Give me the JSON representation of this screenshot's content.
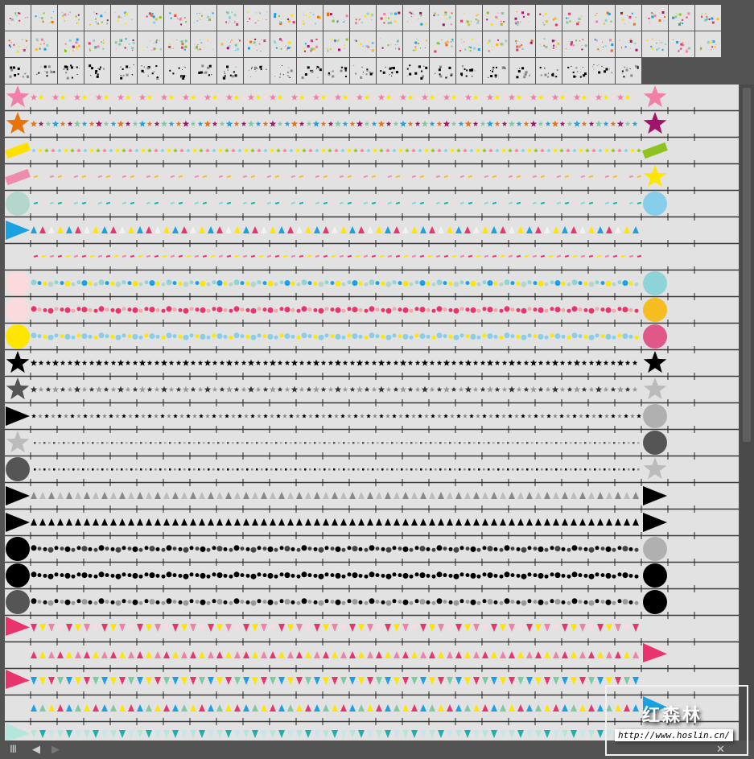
{
  "panel": {
    "watermark_title": "红森林",
    "watermark_url": "http://www.hoslin.cn/",
    "bottom_icons": [
      "brush-libraries-menu-icon",
      "previous-library-icon",
      "next-library-icon",
      "delete-brush-icon"
    ]
  },
  "thumbnail_rows": [
    {
      "count": 27,
      "style": "color"
    },
    {
      "count": 27,
      "style": "color"
    },
    {
      "count": 24,
      "style": "black"
    }
  ],
  "palette": [
    "#f080a8",
    "#ffe600",
    "#e8336d",
    "#1ba1e2",
    "#7ecba1",
    "#f6bd23",
    "#e8720c",
    "#8ed3d8",
    "#a0146a",
    "#8dc21f"
  ],
  "brush_rows": [
    {
      "left": {
        "shape": "star",
        "color": "#f080a8"
      },
      "right": {
        "shape": "star",
        "color": "#f080a8"
      },
      "pattern": {
        "shape": "star",
        "colors": [
          "#f080a8",
          "#ffe600",
          "#fadadd"
        ]
      }
    },
    {
      "left": {
        "shape": "star",
        "color": "#e8720c"
      },
      "right": {
        "shape": "star",
        "color": "#a0146a"
      },
      "pattern": {
        "shape": "star",
        "colors": [
          "#e8720c",
          "#a0146a",
          "#7ecba1",
          "#1ba1e2"
        ]
      }
    },
    {
      "left": {
        "shape": "rect",
        "color": "#ffe000"
      },
      "right": {
        "shape": "rect",
        "color": "#8dc21f"
      },
      "pattern": {
        "shape": "mix",
        "colors": [
          "#87ceeb",
          "#ffe600",
          "#8dc21f",
          "#f080a8"
        ]
      }
    },
    {
      "left": {
        "shape": "rect",
        "color": "#f08cab"
      },
      "right": {
        "shape": "star",
        "color": "#ffe600"
      },
      "pattern": {
        "shape": "dash",
        "colors": [
          "#f6bd23",
          "#fadadd",
          "#f08cab"
        ]
      }
    },
    {
      "left": {
        "shape": "circle",
        "color": "#b5d6cc"
      },
      "right": {
        "shape": "circle",
        "color": "#87ceeb"
      },
      "pattern": {
        "shape": "dash",
        "colors": [
          "#1bb0b0",
          "#fadadd",
          "#8ed3d8"
        ]
      }
    },
    {
      "left": {
        "shape": "tri",
        "color": "#1ba1e2"
      },
      "right": null,
      "pattern": {
        "shape": "tri",
        "colors": [
          "#1ba1e2",
          "#e8336d",
          "#f2f2f2",
          "#ffe600"
        ]
      }
    },
    {
      "left": null,
      "right": null,
      "pattern": {
        "shape": "dash",
        "colors": [
          "#e8336d",
          "#ffe600",
          "#f080a8"
        ]
      }
    },
    {
      "left": {
        "shape": "circle",
        "color": "#fadadd"
      },
      "right": {
        "shape": "circle",
        "color": "#8ed3d8"
      },
      "pattern": {
        "shape": "dot",
        "colors": [
          "#8ed3d8",
          "#1ba1e2",
          "#ffe600",
          "#b5d6cc"
        ]
      }
    },
    {
      "left": {
        "shape": "circle",
        "color": "#fadadd"
      },
      "right": {
        "shape": "circle",
        "color": "#f6bd23"
      },
      "pattern": {
        "shape": "dot",
        "colors": [
          "#e8336d",
          "#f4a9a0",
          "#e8336d"
        ]
      }
    },
    {
      "left": {
        "shape": "circle",
        "color": "#ffe600"
      },
      "right": {
        "shape": "circle",
        "color": "#e0588a"
      },
      "pattern": {
        "shape": "dot",
        "colors": [
          "#87ceeb",
          "#87ceeb",
          "#ffe600"
        ]
      }
    },
    {
      "left": {
        "shape": "star",
        "color": "#000000"
      },
      "right": {
        "shape": "star",
        "color": "#000000"
      },
      "pattern": {
        "shape": "star",
        "colors": [
          "#000000"
        ]
      }
    },
    {
      "left": {
        "shape": "star",
        "color": "#555555"
      },
      "right": {
        "shape": "star",
        "color": "#bbbbbb"
      },
      "pattern": {
        "shape": "star",
        "colors": [
          "#333333",
          "#999999"
        ]
      }
    },
    {
      "left": {
        "shape": "tri",
        "color": "#000000"
      },
      "right": {
        "shape": "circle",
        "color": "#b0b0b0"
      },
      "pattern": {
        "shape": "mix",
        "colors": [
          "#000000",
          "#888888"
        ]
      }
    },
    {
      "left": {
        "shape": "star",
        "color": "#bbbbbb"
      },
      "right": {
        "shape": "circle",
        "color": "#555555"
      },
      "pattern": {
        "shape": "tiny",
        "colors": [
          "#555555",
          "#aaaaaa"
        ]
      }
    },
    {
      "left": {
        "shape": "circle",
        "color": "#555555"
      },
      "right": {
        "shape": "star",
        "color": "#bbbbbb"
      },
      "pattern": {
        "shape": "tiny",
        "colors": [
          "#000000",
          "#888888"
        ]
      }
    },
    {
      "left": {
        "shape": "tri",
        "color": "#000000"
      },
      "right": {
        "shape": "tri",
        "color": "#000000"
      },
      "pattern": {
        "shape": "tri",
        "colors": [
          "#888888",
          "#bbbbbb"
        ]
      }
    },
    {
      "left": {
        "shape": "tri",
        "color": "#000000"
      },
      "right": {
        "shape": "tri",
        "color": "#000000"
      },
      "pattern": {
        "shape": "tri",
        "colors": [
          "#000000"
        ]
      }
    },
    {
      "left": {
        "shape": "circle",
        "color": "#000000"
      },
      "right": {
        "shape": "circle",
        "color": "#b0b0b0"
      },
      "pattern": {
        "shape": "dot",
        "colors": [
          "#000000",
          "#444444"
        ]
      }
    },
    {
      "left": {
        "shape": "circle",
        "color": "#000000"
      },
      "right": {
        "shape": "circle",
        "color": "#000000"
      },
      "pattern": {
        "shape": "dot",
        "colors": [
          "#000000"
        ]
      }
    },
    {
      "left": {
        "shape": "circle",
        "color": "#555555"
      },
      "right": {
        "shape": "circle",
        "color": "#000000"
      },
      "pattern": {
        "shape": "dot",
        "colors": [
          "#000000",
          "#999999"
        ]
      }
    },
    {
      "left": {
        "shape": "flag",
        "color": "#e8336d"
      },
      "right": null,
      "pattern": {
        "shape": "pennant",
        "colors": [
          "#e8336d",
          "#ffe600",
          "#f080a8",
          "#fadadd"
        ]
      }
    },
    {
      "left": null,
      "right": {
        "shape": "flag",
        "color": "#e8336d"
      },
      "pattern": {
        "shape": "tri",
        "colors": [
          "#e8336d",
          "#ffe600",
          "#f080a8"
        ]
      }
    },
    {
      "left": {
        "shape": "flag",
        "color": "#e8336d"
      },
      "right": null,
      "pattern": {
        "shape": "pennant",
        "colors": [
          "#1ba1e2",
          "#ffe600",
          "#e8336d",
          "#7ecba1"
        ]
      }
    },
    {
      "left": null,
      "right": {
        "shape": "flag",
        "color": "#1ba1e2"
      },
      "pattern": {
        "shape": "tri",
        "colors": [
          "#1ba1e2",
          "#7ecba1",
          "#ffe600",
          "#e8336d"
        ]
      }
    },
    {
      "left": {
        "shape": "flag",
        "color": "#b5e6dc"
      },
      "right": null,
      "pattern": {
        "shape": "pennant",
        "colors": [
          "#b5e6dc",
          "#1bb0b0",
          "#c6e6ef"
        ]
      }
    }
  ]
}
